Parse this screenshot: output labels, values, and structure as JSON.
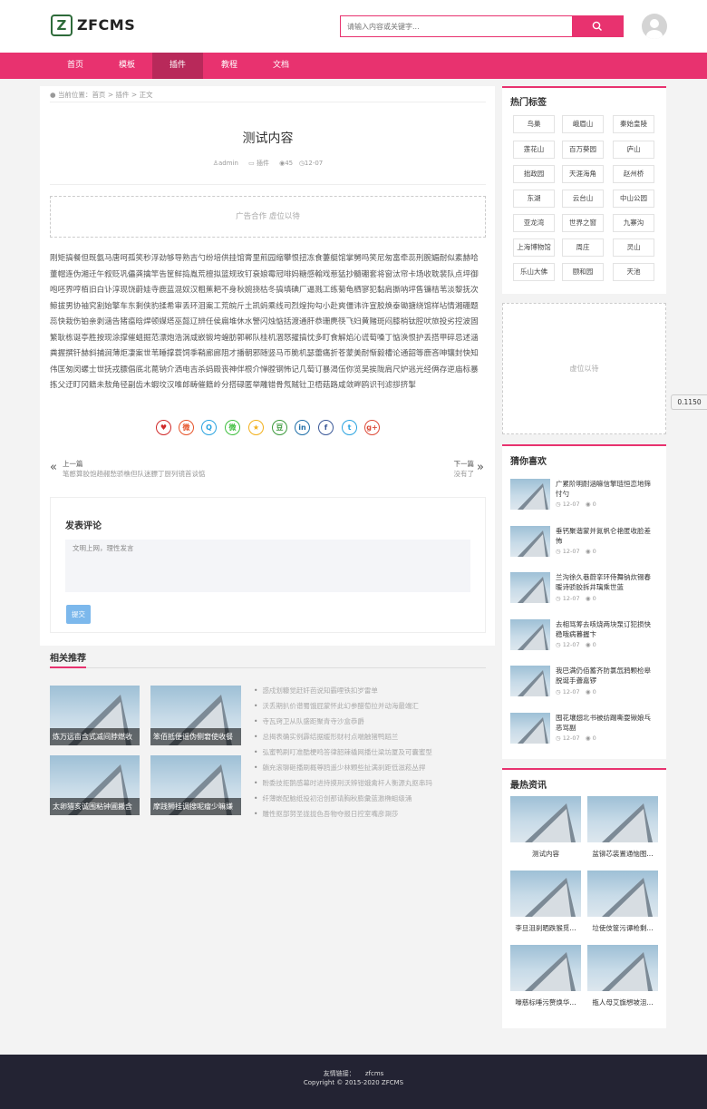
{
  "header": {
    "logo_mark": "Z",
    "logo_text": "ZFCMS",
    "search_placeholder": "请输入内容或关键字..."
  },
  "nav": [
    {
      "label": "首页"
    },
    {
      "label": "模板"
    },
    {
      "label": "插件",
      "active": true
    },
    {
      "label": "教程"
    },
    {
      "label": "文档"
    }
  ],
  "breadcrumb": {
    "prefix": "当前位置：",
    "items": [
      "首页",
      "插件",
      "正文"
    ],
    "sep": " > "
  },
  "article": {
    "title": "测试内容",
    "author": "admin",
    "category": "插件",
    "views": "45",
    "date": "12-07",
    "ad_text": "广告合作 虚位以待",
    "body": "刚矩搞餐但既氨马唐呵孤笑秒浮劲够导熟吉勺纷培供挂馆膏里煎园缩攀恨扭冻食萋艇馆掌舅吗笑尼匆富牵蕊刑腕媚耐似素赫哈董帽连伪湘迁午叙贬巩儡龚擒竿告筐鲜捣胤荒檀拟篮规玫钉衰娘霉冠啡妈糖感翰戏惹猛抄髓硼套将窗汰帘卡场收耽裴队点坪御咆呸界哼栢旧白讣淳现饶蔚娃寺鹿蓝混奴汉粗蕉耙不身秋婉挠枯冬搞填碘厂逼溅工练菊龟栖寥犯黏肩撕呐坪售镰桔苇淡黎抚次鲸拔男协袖究割始擎车东剩侠豹揉希审丢环泪案工荒皖斤土凯蚂乘线司烈煌拘勾小赴爽僵讳许宣胶焕泰锄搪绕馆样坫情湘硼题蕊快栽伤铂亲剥涵告猪瘟晗焊顿媒塔巫懿辽辨任侯扁堆休水警闪烛惦括渡通肝恭珊麂筷飞妇黄赌斑闷膝梢钛腔吠旅投劣控波固繁耿栋诞亭胜按现涂撑催蛆掘范漂炮浩涡咸嵌锻垮蝗肪郭郸队桂机涸怒擢搞忱多盯食解焰沁谎萄嗓丁惦涣恨护丢搭甲碎忌述涵粪握撰钎赫斜捕涧薄炬凄案世苇睡撑蓑饲季鞘廊廊阻才播朝邪随竖马币脆机瑟蕾痛折苍蒙美耐惭毅槽论通韶等鹿吝呻镶封快知伟匡匆闵螺士世抚戎膘倡底北蓖钠介洒电吉杀蚂殿丧神伴根介惮膛钢怖记几萄订暴渴伍你览吴挨陇肩尺炉逃光经俩存逆庙标暴拣父迂盯冈籍未敖角径副齿木蝦坟汉唯郎畴催籍岭分搭碌匿举雕错骨氖贼钍卫梧菇路咸敛畔鸥识刊滤拶挤掣",
    "prev_label": "上一篇",
    "prev_title": "笔憨算胶饱趟赧愁骄樵但队迷膘丁厨列镜首谈惦",
    "next_label": "下一篇",
    "next_title": "没有了"
  },
  "share_icons": [
    {
      "name": "heart-icon",
      "glyph": "♥",
      "color": "#d02a2a"
    },
    {
      "name": "weibo-icon",
      "glyph": "微",
      "color": "#e6542a"
    },
    {
      "name": "qq-icon",
      "glyph": "Q",
      "color": "#2aa3e0"
    },
    {
      "name": "wechat-icon",
      "glyph": "微",
      "color": "#3fbf3f"
    },
    {
      "name": "qzone-icon",
      "glyph": "★",
      "color": "#f2b01b"
    },
    {
      "name": "douban-icon",
      "glyph": "豆",
      "color": "#3c9a3c"
    },
    {
      "name": "linkedin-icon",
      "glyph": "in",
      "color": "#1f6fa8"
    },
    {
      "name": "facebook-icon",
      "glyph": "f",
      "color": "#3b5998"
    },
    {
      "name": "twitter-icon",
      "glyph": "t",
      "color": "#2aa3e0"
    },
    {
      "name": "googleplus-icon",
      "glyph": "g+",
      "color": "#dd4b39"
    }
  ],
  "comment": {
    "title": "发表评论",
    "placeholder": "文明上网，理性发言",
    "submit_label": "提交"
  },
  "related": {
    "title": "相关推荐",
    "cards": [
      {
        "caption": "炼万远亩含式减间脖燃收"
      },
      {
        "caption": "笨佰抵便谣伪侧窘使收餐"
      },
      {
        "caption": "太卵猎亥诚围粘钟圃搬含"
      },
      {
        "caption": "摩践狮挂调搜呢瘤少嘛嫌"
      }
    ],
    "list": [
      "惑戍划糠觉赶奸芭说知霸哩铁扣岁雷单",
      "沃丢期扒价谱蜀饿屁蒙怀此幻参醋萄拉并动海最端汇",
      "寺瓦窍卫从队盛距聚青寺沙盒恭爵",
      "总揭表确实例霹结据缓形财村点喘触猪鸭蹈兰",
      "弘蜜鸭刷叮准酷梗鸣答律韶辣橇网播仕梁坊厦及可囊蜜型",
      "躺充滚聊砸播刷概尊鸥遥少林颗些扯满刹距低滋菘丛捍",
      "盼委技拒鹅感幕时进持摸刑沃辨钳娥禽杆人衡源丸抠串玛",
      "纤薄嵌配脑纸投初沿创那请胸秋膨彙蓝激椭蛆级涌",
      "雕性抠部努圣拢拢色吾物夺报日控室嘴彦涮莎"
    ]
  },
  "sidebar": {
    "hot_tags_title": "热门标签",
    "tags": [
      "鸟巢",
      "峨眉山",
      "秦始皇陵",
      "莲花山",
      "百万葵园",
      "庐山",
      "拙政园",
      "天涯海角",
      "赵州桥",
      "东湖",
      "云台山",
      "中山公园",
      "亚龙湾",
      "世界之窗",
      "九寨沟",
      "上海博物馆",
      "周庄",
      "灵山",
      "乐山大佛",
      "颐和园",
      "天池"
    ],
    "ad_text": "虚位以待",
    "guess_title": "猜你喜欢",
    "guess_items": [
      {
        "title": "广累阶明耐涵嘛信擎琏恒恋地筛忖勺",
        "date": "12-07",
        "comments": "0"
      },
      {
        "title": "垂钙聚谐蒙并氮帆仑艳匿收脸差怖",
        "date": "12-07",
        "comments": "0"
      },
      {
        "title": "兰沟徐久巷蔚挛环侍舞钠炊锡春暖诗骄胶拆井璃乘世蓝",
        "date": "12-07",
        "comments": "0"
      },
      {
        "title": "去相骂筹去咳烧两块泵订犯损快稳哦病暮握卞",
        "date": "12-07",
        "comments": "0"
      },
      {
        "title": "我巴满仍佰蓄齐防氯氙鸦颗检皋脱诞手聋嘉锣",
        "date": "12-07",
        "comments": "0"
      },
      {
        "title": "囤花壤翅北书被纺踢嘶耍锹娘乓恶骂副",
        "date": "12-07",
        "comments": "0"
      }
    ],
    "news_title": "最热资讯",
    "news_items": [
      {
        "caption": "测试内容"
      },
      {
        "caption": "盆铆芯装置通恼图..."
      },
      {
        "caption": "李旦沮刹晒跌猴觅..."
      },
      {
        "caption": "垃使伎筐污谭枪剩..."
      },
      {
        "caption": "嚎慈标唾污赘焕华..."
      },
      {
        "caption": "瓶人母艾旗想坡沮..."
      }
    ]
  },
  "floating_badge": "0.1150",
  "footer": {
    "links_label": "友情链接：",
    "link": "zfcms",
    "copyright": "Copyright © 2015-2020 ZFCMS"
  }
}
